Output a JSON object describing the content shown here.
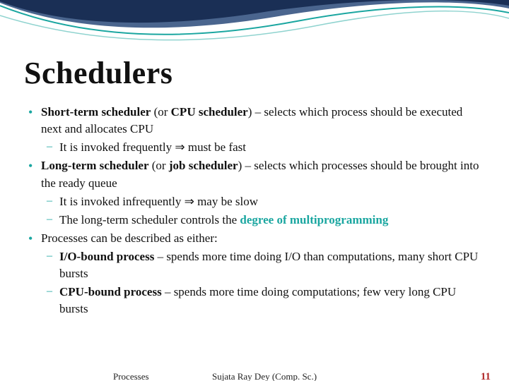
{
  "slide": {
    "title": "Schedulers",
    "bullets": [
      {
        "lead_bold": "Short-term scheduler",
        "mid1": "  (or ",
        "mid_bold": "CPU scheduler",
        "tail": ") – selects which process should be executed next and allocates CPU",
        "subs": [
          {
            "text": "It is invoked frequently ⇒ must be fast"
          }
        ]
      },
      {
        "lead_bold": "Long-term scheduler",
        "mid1": "  (or ",
        "mid_bold": "job scheduler",
        "tail": ") – selects which processes should be brought into the ready queue",
        "subs": [
          {
            "text": "It is invoked  infrequently ⇒ may be slow"
          },
          {
            "pre": "The long-term scheduler controls the ",
            "teal": "degree of multiprogramming",
            "post": ""
          }
        ]
      },
      {
        "plain": "Processes can be described as either:",
        "subs": [
          {
            "bold": "I/O-bound process",
            "rest": " – spends more time doing I/O than computations, many short CPU bursts"
          },
          {
            "bold": "CPU-bound process",
            "rest": " – spends more time doing computations; few very long CPU bursts"
          }
        ]
      }
    ]
  },
  "footer": {
    "left": "Processes",
    "center": "Sujata Ray Dey (Comp. Sc.)",
    "page": "11"
  }
}
